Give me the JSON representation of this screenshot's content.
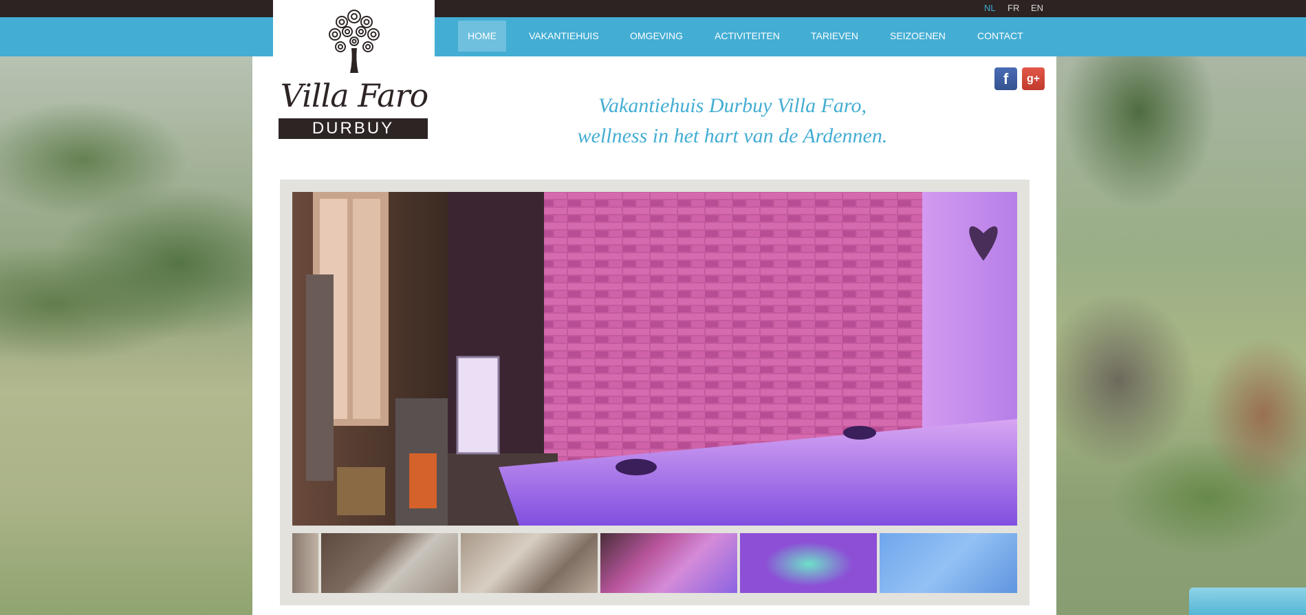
{
  "languages": [
    {
      "label": "NL",
      "active": true
    },
    {
      "label": "FR",
      "active": false
    },
    {
      "label": "EN",
      "active": false
    }
  ],
  "nav": {
    "items": [
      {
        "label": "HOME",
        "active": true
      },
      {
        "label": "VAKANTIEHUIS",
        "active": false
      },
      {
        "label": "OMGEVING",
        "active": false
      },
      {
        "label": "ACTIVITEITEN",
        "active": false
      },
      {
        "label": "TARIEVEN",
        "active": false
      },
      {
        "label": "SEIZOENEN",
        "active": false
      },
      {
        "label": "CONTACT",
        "active": false
      }
    ]
  },
  "logo": {
    "name": "Villa Faro",
    "place": "DURBUY",
    "icon": "tree-icon"
  },
  "social": {
    "facebook": {
      "glyph": "f",
      "icon": "facebook-icon"
    },
    "googleplus": {
      "glyph": "g+",
      "icon": "google-plus-icon"
    }
  },
  "tagline": {
    "line1": "Vakantiehuis Durbuy Villa Faro,",
    "line2": "wellness in het hart van de Ardennen."
  },
  "colors": {
    "accent": "#43add3",
    "topbar": "#2c2322",
    "nav_active": "#6ec0de",
    "logo_dark": "#2d2424"
  },
  "slider": {
    "main_image": "hot tub room with purple lighting and brick wall",
    "thumbnails": [
      "partial thumbnail",
      "kitchen",
      "dining room",
      "hot tub room",
      "indoor pool",
      "sauna"
    ]
  }
}
